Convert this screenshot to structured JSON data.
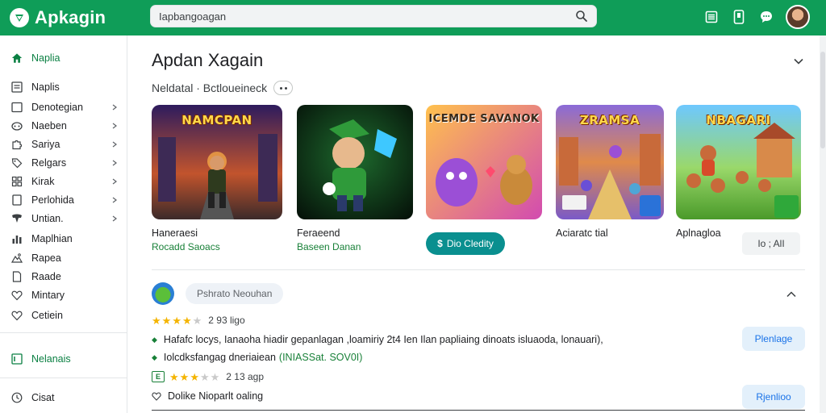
{
  "app": {
    "name": "Apkagin"
  },
  "search": {
    "value": "Iapbangoagan",
    "placeholder": ""
  },
  "header": {
    "icons": [
      "list-icon",
      "phone-icon",
      "chat-icon",
      "avatar"
    ]
  },
  "sidebar": {
    "items": [
      {
        "label": "Naplia",
        "icon": "home-icon",
        "chevron": false,
        "active": true
      },
      {
        "label": "Naplis",
        "icon": "list-icon",
        "chevron": false,
        "active": false
      },
      {
        "label": "Denotegian",
        "icon": "square-icon",
        "chevron": true,
        "active": false
      },
      {
        "label": "Naeben",
        "icon": "gamepad-icon",
        "chevron": true,
        "active": false
      },
      {
        "label": "Sariya",
        "icon": "puzzle-icon",
        "chevron": true,
        "active": false
      },
      {
        "label": "Relgars",
        "icon": "tag-icon",
        "chevron": true,
        "active": false
      },
      {
        "label": "Kirak",
        "icon": "grid-icon",
        "chevron": true,
        "active": false
      },
      {
        "label": "Perlohida",
        "icon": "square-icon",
        "chevron": true,
        "active": false
      },
      {
        "label": "Untian.",
        "icon": "shield-icon",
        "chevron": true,
        "active": false
      },
      {
        "label": "Maplhian",
        "icon": "chart-icon",
        "chevron": false,
        "active": false
      },
      {
        "label": "Rapea",
        "icon": "mountain-icon",
        "chevron": false,
        "active": false
      },
      {
        "label": "Raade",
        "icon": "doc-icon",
        "chevron": false,
        "active": false
      },
      {
        "label": "Mintary",
        "icon": "heart-icon",
        "chevron": false,
        "active": false
      },
      {
        "label": "Cetiein",
        "icon": "heart-icon",
        "chevron": false,
        "active": false
      }
    ],
    "section_item": {
      "label": "Nelanais",
      "icon": "list-icon"
    },
    "footer_item": {
      "label": "Cisat",
      "icon": "clock-icon"
    }
  },
  "main": {
    "title": "Apdan Xagain",
    "subtitle": "Neldatal · Bctloueineck",
    "cards": [
      {
        "thumb_title": "NAMCPAN",
        "name": "Haneraesi",
        "developer": "Rocadd Saoacs"
      },
      {
        "thumb_title": "",
        "name": "Feraeend",
        "developer": "Baseen Danan"
      },
      {
        "thumb_title": "ICEMDE SAVANOK",
        "name": "",
        "developer": "",
        "button": "Dio Cledity"
      },
      {
        "thumb_title": "ZRAMSA",
        "name": "Aciaratc tial",
        "developer": ""
      },
      {
        "thumb_title": "NBAGARI",
        "name": "Aplnagloa",
        "developer": "",
        "button": "Io ; AlI"
      }
    ],
    "review": {
      "chip": "Pshrato Neouhan",
      "ratings": [
        {
          "stars": 4,
          "text": "2 93 ligo"
        },
        {
          "stars": 3,
          "text": "2 13 agp"
        }
      ],
      "bullets": [
        {
          "text": "Hafafc locys, Ianaoha hiadir gepanlagan ,loamiriy 2t4 Ien Ilan papliaing dinoats isluaoda, lonauari),",
          "green": ""
        },
        {
          "text": "Iolcdksfangag dneriaiean",
          "green": "(INIASSat. SOV0I)"
        }
      ],
      "note": "Dolike Nioparlt oaling",
      "buttons": [
        "Plenlage",
        "Rjenlioo"
      ]
    }
  },
  "colors": {
    "brand": "#0f9d58",
    "link": "#188038",
    "accent": "#0a8f8f"
  }
}
